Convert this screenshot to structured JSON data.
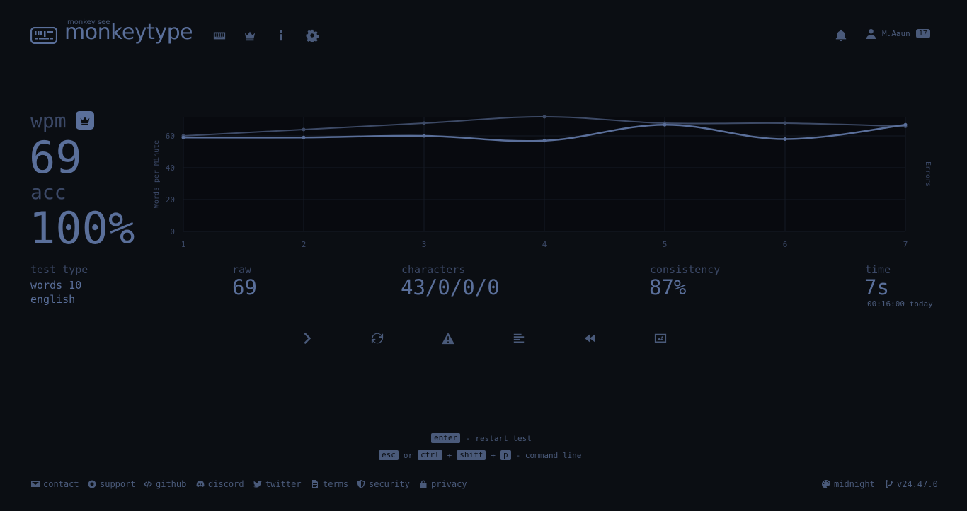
{
  "header": {
    "logo_top": "monkey see",
    "logo_text": "monkeytype",
    "nav": [
      "keyboard-icon",
      "crown-icon",
      "info-icon",
      "gear-icon"
    ],
    "username": "M.Aaun",
    "level": "17"
  },
  "result": {
    "wpm_label": "wpm",
    "wpm": "69",
    "acc_label": "acc",
    "acc": "100%"
  },
  "stats": {
    "test_type_label": "test type",
    "test_type_line1": "words 10",
    "test_type_line2": "english",
    "raw_label": "raw",
    "raw": "69",
    "characters_label": "characters",
    "characters": "43/0/0/0",
    "consistency_label": "consistency",
    "consistency": "87%",
    "time_label": "time",
    "time": "7s",
    "time_sub": "00:16:00 today"
  },
  "chart_data": {
    "type": "line",
    "x": [
      1,
      2,
      3,
      4,
      5,
      6,
      7
    ],
    "series": [
      {
        "values": [
          60,
          64,
          68,
          72,
          68,
          68,
          66
        ]
      },
      {
        "values": [
          59,
          59,
          60,
          57,
          67,
          58,
          67
        ]
      }
    ],
    "ylabel": "Words per Minute",
    "y2label": "Errors",
    "ylim": [
      0,
      72
    ],
    "yticks": [
      0,
      20,
      40,
      60
    ],
    "grid": true,
    "colors": [
      "#3d4a66",
      "#5a6f9a"
    ]
  },
  "actions": [
    "next-icon",
    "restart-icon",
    "warning-icon",
    "words-history-icon",
    "replay-icon",
    "screenshot-icon"
  ],
  "hints": {
    "enter_key": "enter",
    "restart_text": "- restart test",
    "esc_key": "esc",
    "or_text": "or",
    "ctrl_key": "ctrl",
    "plus1": "+",
    "shift_key": "shift",
    "plus2": "+",
    "p_key": "p",
    "command_text": "- command line"
  },
  "footer": {
    "contact": "contact",
    "support": "support",
    "github": "github",
    "discord": "discord",
    "twitter": "twitter",
    "terms": "terms",
    "security": "security",
    "privacy": "privacy",
    "theme": "midnight",
    "version": "v24.47.0"
  },
  "colors": {
    "background": "#0b0e13",
    "main": "#5a6f9a",
    "sub": "#3b4866"
  }
}
